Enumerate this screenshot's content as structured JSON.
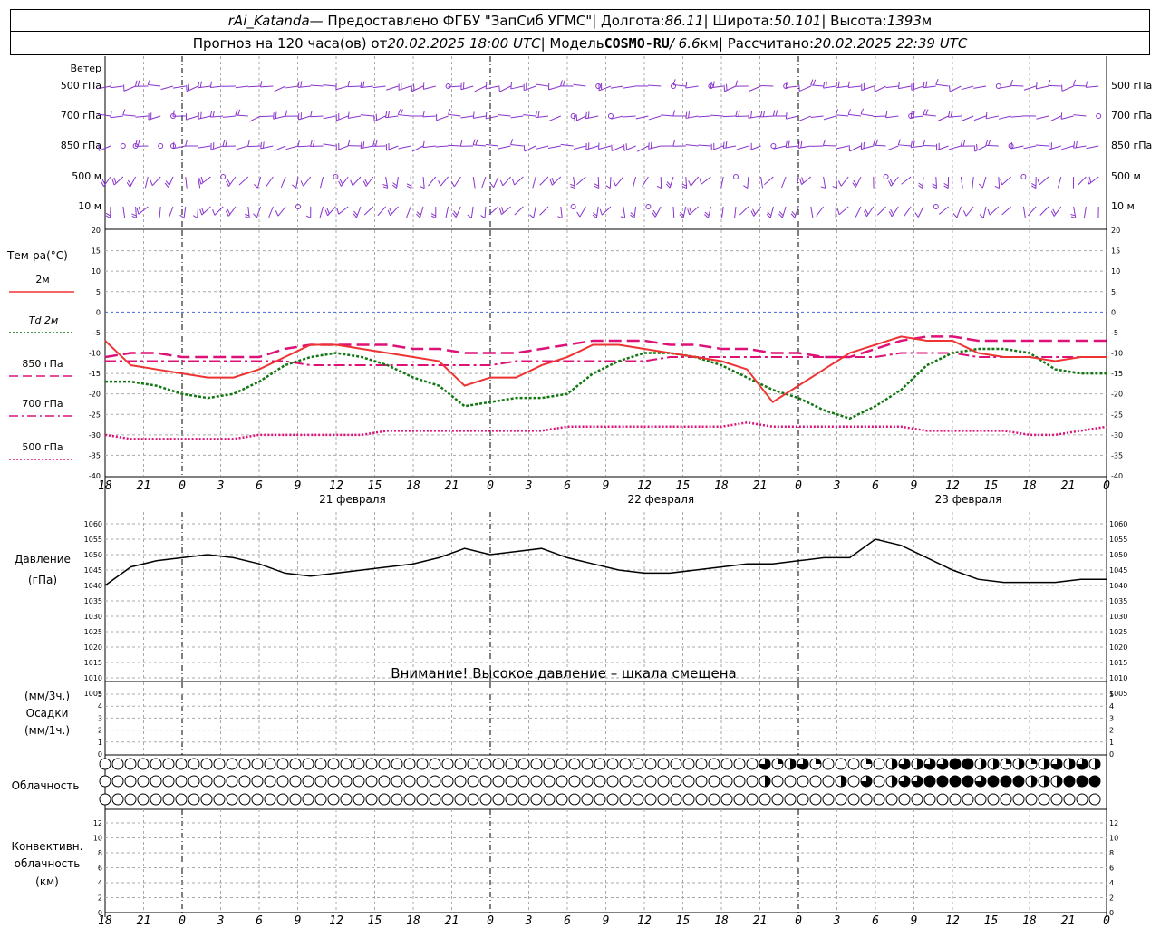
{
  "header": {
    "station": "rAi_Katanda",
    "provider": "— Предоставлено ФГБУ \"ЗапСиб УГМС\"",
    "lon_label": "| Долгота:",
    "lon": "86.11",
    "lat_label": "| Широта:",
    "lat": "50.101",
    "alt_label": "| Высота:",
    "alt": "1393",
    "alt_unit": "м",
    "fc_prefix": "Прогноз на 120 часа(ов) от",
    "fc_time": "20.02.2025 18:00 UTC",
    "model_label": "| Модель",
    "model": "COSMO-RU",
    "model_res": "/ 6.6",
    "model_unit": "км",
    "calc_label": "| Рассчитано:",
    "calc_time": "20.02.2025 22:39 UTC"
  },
  "wind_panel": {
    "title": "Ветер",
    "levels": [
      "500 гПа",
      "700 гПа",
      "850 гПа",
      "500 м",
      "10 м"
    ]
  },
  "temp_panel": {
    "title": "Тем-ра(°C)",
    "legend": [
      {
        "label": "2м",
        "color": "#ee3333",
        "dash": "solid"
      },
      {
        "label": "Td 2м",
        "color": "#117711",
        "dash": "dotted"
      },
      {
        "label": "850 гПа",
        "color": "#dd1177",
        "dash": "long"
      },
      {
        "label": "700 гПа",
        "color": "#dd1177",
        "dash": "dashdot"
      },
      {
        "label": "500 гПа",
        "color": "#dd1177",
        "dash": "dotted"
      }
    ],
    "ylim": [
      -40,
      20
    ],
    "yticks": [
      20,
      15,
      10,
      5,
      0,
      -5,
      -10,
      -15,
      -20,
      -25,
      -30,
      -35,
      -40
    ]
  },
  "pressure_panel": {
    "title": "Давление",
    "unit": "(гПа)",
    "ylim": [
      1005,
      1060
    ],
    "yticks": [
      1060,
      1055,
      1050,
      1045,
      1040,
      1035,
      1030,
      1025,
      1020,
      1015,
      1010,
      1005
    ],
    "warning": "Внимание! Высокое давление – шкала смещена"
  },
  "precip_panel": {
    "label1": "(мм/3ч.)",
    "label2": "Осадки",
    "label3": "(мм/1ч.)",
    "yticks": [
      5,
      4,
      3,
      2,
      1,
      0
    ]
  },
  "cloud_panel": {
    "title": "Облачность"
  },
  "conv_panel": {
    "label1": "Конвективн.",
    "label2": "облачность",
    "label3": "(км)",
    "yticks": [
      12,
      10,
      8,
      6,
      4,
      2,
      0
    ]
  },
  "time_axis": {
    "hour_labels": [
      "18",
      "21",
      "0",
      "3",
      "6",
      "9",
      "12",
      "15",
      "18",
      "21",
      "0",
      "3",
      "6",
      "9",
      "12",
      "15",
      "18",
      "21",
      "0",
      "3",
      "6",
      "9",
      "12",
      "15",
      "18",
      "21",
      "0"
    ],
    "dates": [
      "21 февраля",
      "22 февраля",
      "23 февраля"
    ]
  },
  "chart_data": {
    "type": "line",
    "x_hours_from_start": [
      0,
      3,
      6,
      9,
      12,
      15,
      18,
      21,
      24,
      27,
      30,
      33,
      36,
      39,
      42,
      45,
      48,
      51,
      54,
      57,
      60,
      63,
      66,
      69,
      72,
      75,
      78
    ],
    "series": [
      {
        "name": "2м",
        "values": [
          -7,
          -13,
          -14,
          -15,
          -16,
          -16,
          -14,
          -11,
          -8,
          -8,
          -9,
          -10,
          -11,
          -12,
          -18,
          -16,
          -16,
          -13,
          -11,
          -8,
          -8,
          -9,
          -10,
          -11,
          -12,
          -14,
          -22,
          -18,
          -14,
          -10,
          -8,
          -6,
          -7,
          -7,
          -10,
          -11,
          -11,
          -12,
          -11,
          -11
        ]
      },
      {
        "name": "Td 2м",
        "values": [
          -17,
          -17,
          -18,
          -20,
          -21,
          -20,
          -17,
          -13,
          -11,
          -10,
          -11,
          -13,
          -16,
          -18,
          -23,
          -22,
          -21,
          -21,
          -20,
          -15,
          -12,
          -10,
          -10,
          -11,
          -13,
          -16,
          -19,
          -21,
          -24,
          -26,
          -23,
          -19,
          -13,
          -10,
          -9,
          -9,
          -10,
          -14,
          -15,
          -15
        ]
      },
      {
        "name": "850 гПа",
        "values": [
          -11,
          -10,
          -10,
          -11,
          -11,
          -11,
          -11,
          -9,
          -8,
          -8,
          -8,
          -8,
          -9,
          -9,
          -10,
          -10,
          -10,
          -9,
          -8,
          -7,
          -7,
          -7,
          -8,
          -8,
          -9,
          -9,
          -10,
          -10,
          -11,
          -11,
          -9,
          -7,
          -6,
          -6,
          -7,
          -7,
          -7,
          -7,
          -7,
          -7
        ]
      },
      {
        "name": "700 гПа",
        "values": [
          -12,
          -12,
          -12,
          -12,
          -12,
          -12,
          -12,
          -12,
          -13,
          -13,
          -13,
          -13,
          -13,
          -13,
          -13,
          -13,
          -12,
          -12,
          -12,
          -12,
          -12,
          -12,
          -11,
          -11,
          -11,
          -11,
          -11,
          -11,
          -11,
          -11,
          -11,
          -10,
          -10,
          -10,
          -11,
          -11,
          -11,
          -11,
          -11,
          -11
        ]
      },
      {
        "name": "500 гПа",
        "values": [
          -30,
          -31,
          -31,
          -31,
          -31,
          -31,
          -30,
          -30,
          -30,
          -30,
          -30,
          -29,
          -29,
          -29,
          -29,
          -29,
          -29,
          -29,
          -28,
          -28,
          -28,
          -28,
          -28,
          -28,
          -28,
          -27,
          -28,
          -28,
          -28,
          -28,
          -28,
          -28,
          -29,
          -29,
          -29,
          -29,
          -30,
          -30,
          -29,
          -28
        ]
      },
      {
        "name": "Давление",
        "values": [
          1040,
          1046,
          1048,
          1049,
          1050,
          1049,
          1047,
          1044,
          1043,
          1044,
          1045,
          1046,
          1047,
          1049,
          1052,
          1050,
          1051,
          1052,
          1049,
          1047,
          1045,
          1044,
          1044,
          1045,
          1046,
          1047,
          1047,
          1048,
          1049,
          1049,
          1055,
          1053,
          1049,
          1045,
          1042,
          1041,
          1041,
          1041,
          1042,
          1042
        ]
      }
    ],
    "n_points": 40,
    "x_start_hour": 18,
    "x_step_hours": 3
  }
}
